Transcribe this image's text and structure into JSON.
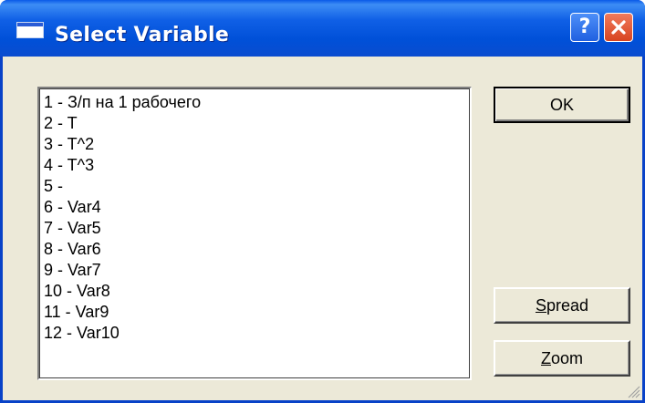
{
  "window": {
    "title": "Select Variable",
    "help_label": "?"
  },
  "list": {
    "items": [
      "1 - З/п на 1 рабочего",
      "2 - T",
      "3 - T^2",
      "4 - T^3",
      "5 -",
      "6 - Var4",
      "7 - Var5",
      "8 - Var6",
      "9 - Var7",
      "10 - Var8",
      "11 - Var9",
      "12 - Var10"
    ]
  },
  "buttons": {
    "ok": "OK",
    "spread_mnemonic": "S",
    "spread_rest": "pread",
    "zoom_mnemonic": "Z",
    "zoom_rest": "oom"
  },
  "icons": {
    "app": "window-icon",
    "help": "help-icon",
    "close": "close-icon",
    "grip": "resize-grip-icon"
  },
  "colors": {
    "titlebar": "#0050d8",
    "dialog": "#ece9d8",
    "close": "#d84420"
  }
}
